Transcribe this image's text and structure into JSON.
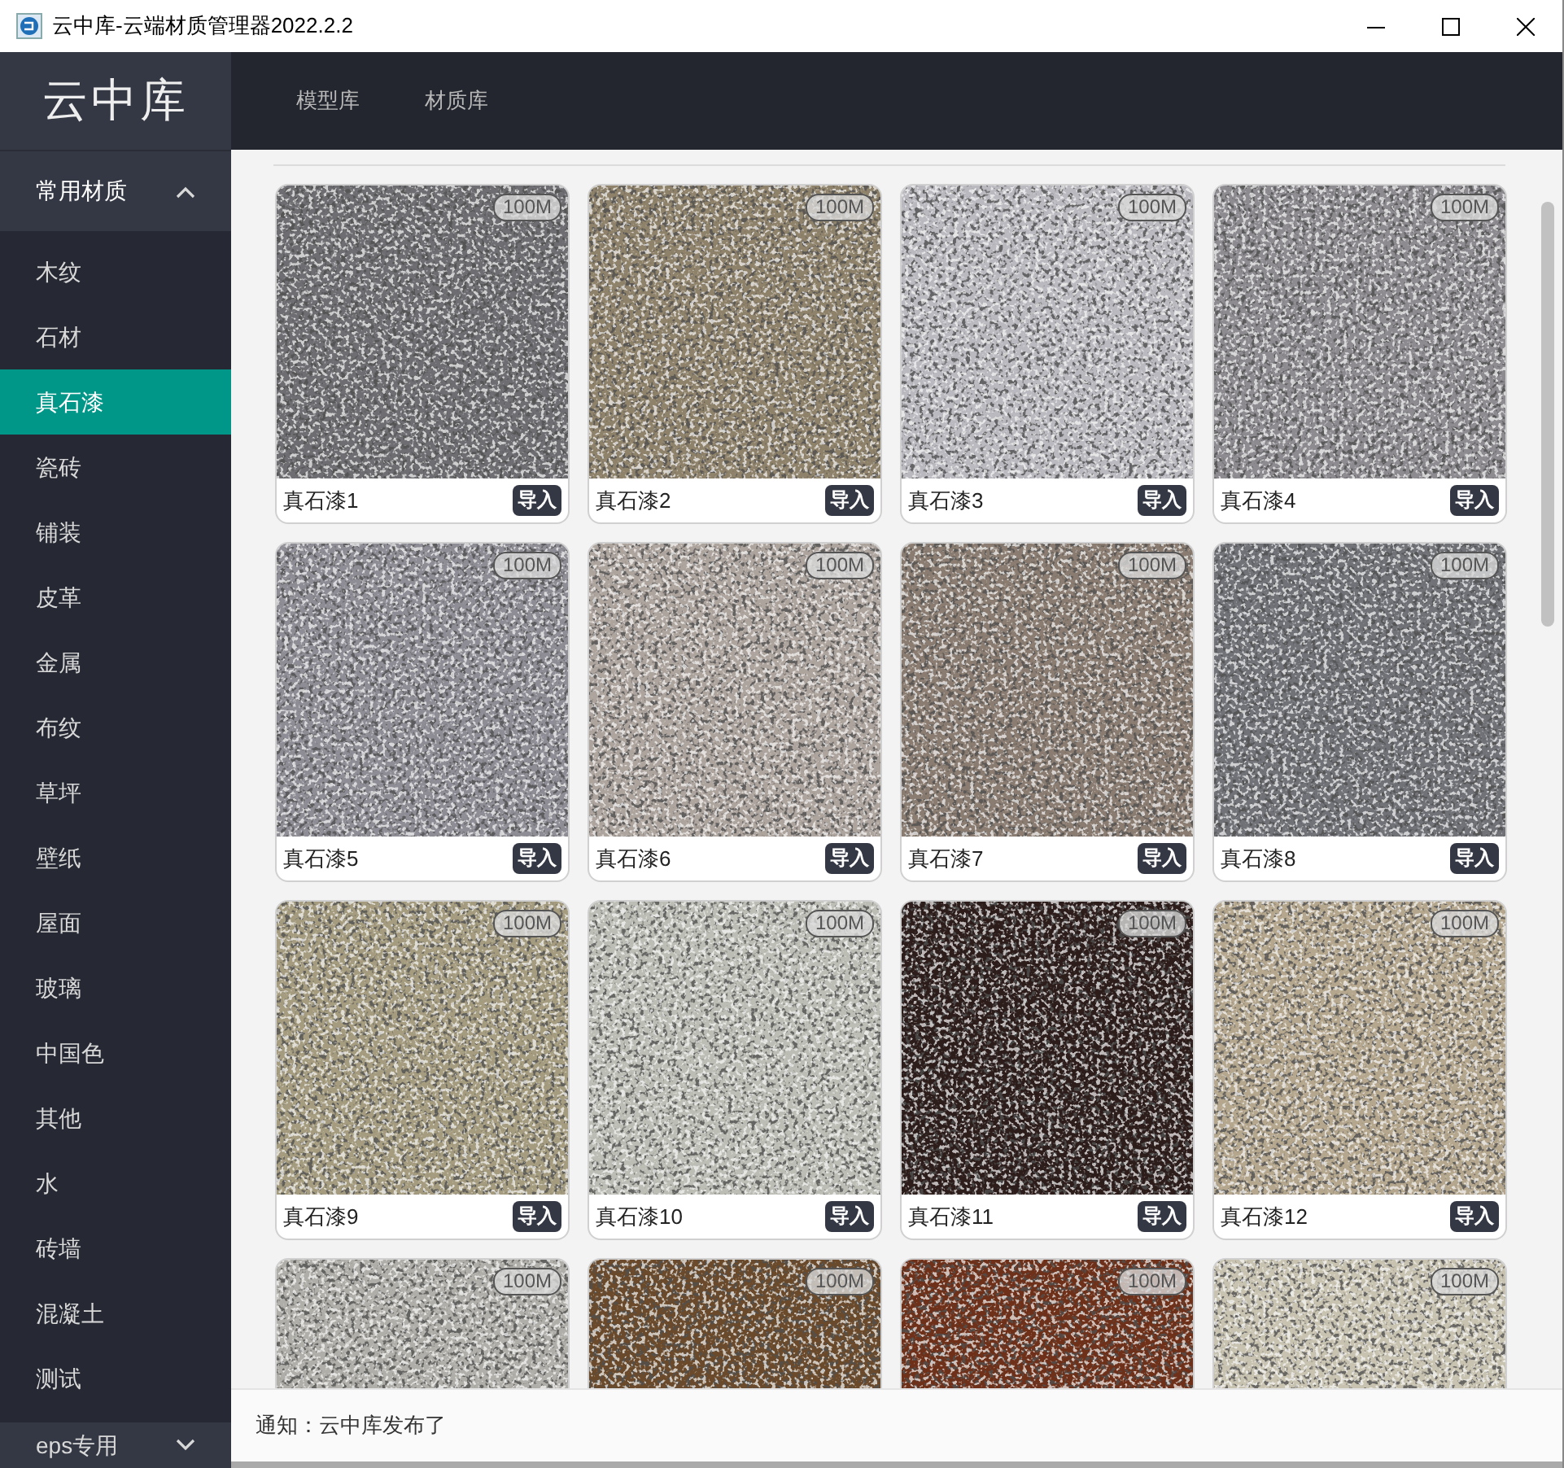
{
  "window": {
    "title": "云中库-云端材质管理器2022.2.2"
  },
  "logo": "云中库",
  "nav": [
    {
      "label": "模型库",
      "selected": false
    },
    {
      "label": "材质库",
      "selected": false
    }
  ],
  "sidebar": {
    "section": {
      "label": "常用材质",
      "expanded": true
    },
    "items": [
      {
        "label": "木纹",
        "selected": false
      },
      {
        "label": "石材",
        "selected": false
      },
      {
        "label": "真石漆",
        "selected": true
      },
      {
        "label": "瓷砖",
        "selected": false
      },
      {
        "label": "铺装",
        "selected": false
      },
      {
        "label": "皮革",
        "selected": false
      },
      {
        "label": "金属",
        "selected": false
      },
      {
        "label": "布纹",
        "selected": false
      },
      {
        "label": "草坪",
        "selected": false
      },
      {
        "label": "壁纸",
        "selected": false
      },
      {
        "label": "屋面",
        "selected": false
      },
      {
        "label": "玻璃",
        "selected": false
      },
      {
        "label": "中国色",
        "selected": false
      },
      {
        "label": "其他",
        "selected": false
      },
      {
        "label": "水",
        "selected": false
      },
      {
        "label": "砖墙",
        "selected": false
      },
      {
        "label": "混凝土",
        "selected": false
      },
      {
        "label": "测试",
        "selected": false
      }
    ],
    "section_2": {
      "label": "eps专用",
      "expanded": false
    }
  },
  "materials": [
    {
      "name": "真石漆1",
      "size": "100M",
      "button": "导入",
      "color": "#6e6e72"
    },
    {
      "name": "真石漆2",
      "size": "100M",
      "button": "导入",
      "color": "#8f826a"
    },
    {
      "name": "真石漆3",
      "size": "100M",
      "button": "导入",
      "color": "#b9b9bf"
    },
    {
      "name": "真石漆4",
      "size": "100M",
      "button": "导入",
      "color": "#8d8a90"
    },
    {
      "name": "真石漆5",
      "size": "100M",
      "button": "导入",
      "color": "#8e8c94"
    },
    {
      "name": "真石漆6",
      "size": "100M",
      "button": "导入",
      "color": "#aea49e"
    },
    {
      "name": "真石漆7",
      "size": "100M",
      "button": "导入",
      "color": "#8a7c70"
    },
    {
      "name": "真石漆8",
      "size": "100M",
      "button": "导入",
      "color": "#707278"
    },
    {
      "name": "真石漆9",
      "size": "100M",
      "button": "导入",
      "color": "#a59c80"
    },
    {
      "name": "真石漆10",
      "size": "100M",
      "button": "导入",
      "color": "#bcbdb4"
    },
    {
      "name": "真石漆11",
      "size": "100M",
      "button": "导入",
      "color": "#2c1c1a"
    },
    {
      "name": "真石漆12",
      "size": "100M",
      "button": "导入",
      "color": "#b5a78e"
    },
    {
      "size": "100M",
      "color": "#b0aea8"
    },
    {
      "size": "100M",
      "color": "#6a4a2a"
    },
    {
      "size": "100M",
      "color": "#6e3018"
    },
    {
      "size": "100M",
      "color": "#c8c2b0"
    }
  ],
  "notification": "通知：云中库发布了"
}
